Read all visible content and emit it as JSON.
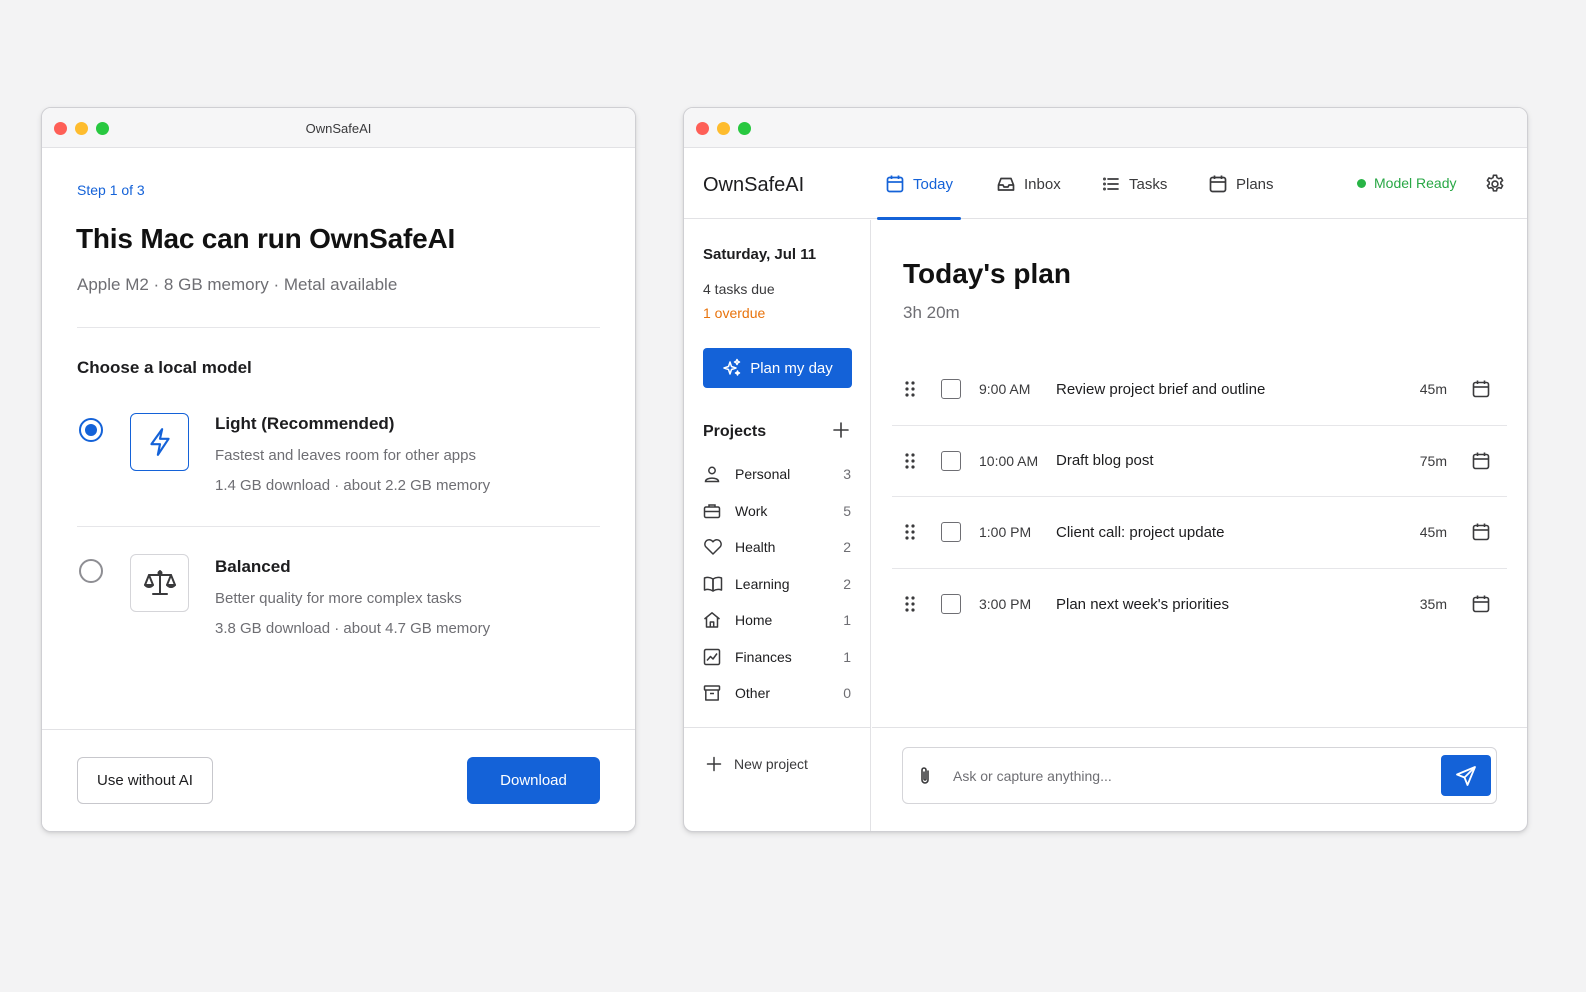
{
  "onboarding": {
    "window_title": "OwnSafeAI",
    "step": "Step 1 of 3",
    "heading": "This Mac can run OwnSafeAI",
    "specs": "Apple M2 · 8 GB memory · Metal available",
    "section_title": "Choose a local model",
    "models": [
      {
        "name": "Light (Recommended)",
        "description": "Fastest and leaves room for other apps",
        "size": "1.4 GB download · about 2.2 GB memory",
        "selected": true,
        "icon": "lightning-icon"
      },
      {
        "name": "Balanced",
        "description": "Better quality for more complex tasks",
        "size": "3.8 GB download · about 4.7 GB memory",
        "selected": false,
        "icon": "scale-icon"
      }
    ],
    "secondary_button": "Use without AI",
    "primary_button": "Download"
  },
  "app": {
    "brand": "OwnSafeAI",
    "tabs": [
      {
        "label": "Today",
        "icon": "calendar-icon",
        "active": true
      },
      {
        "label": "Inbox",
        "icon": "inbox-icon",
        "active": false
      },
      {
        "label": "Tasks",
        "icon": "list-icon",
        "active": false
      },
      {
        "label": "Plans",
        "icon": "calendar-icon",
        "active": false
      }
    ],
    "status": "Model Ready",
    "sidebar": {
      "date": "Saturday, Jul 11",
      "tasks_due": "4 tasks due",
      "overdue": "1 overdue",
      "plan_button": "Plan my day",
      "projects_title": "Projects",
      "projects": [
        {
          "name": "Personal",
          "count": "3",
          "icon": "person-icon"
        },
        {
          "name": "Work",
          "count": "5",
          "icon": "briefcase-icon"
        },
        {
          "name": "Health",
          "count": "2",
          "icon": "heart-icon"
        },
        {
          "name": "Learning",
          "count": "2",
          "icon": "book-icon"
        },
        {
          "name": "Home",
          "count": "1",
          "icon": "house-icon"
        },
        {
          "name": "Finances",
          "count": "1",
          "icon": "chart-icon"
        },
        {
          "name": "Other",
          "count": "0",
          "icon": "archive-icon"
        }
      ],
      "new_project": "New project"
    },
    "main": {
      "title": "Today's plan",
      "duration": "3h 20m",
      "tasks": [
        {
          "time": "9:00 AM",
          "title": "Review project brief and outline",
          "duration": "45m"
        },
        {
          "time": "10:00 AM",
          "title": "Draft blog post",
          "duration": "75m"
        },
        {
          "time": "1:00 PM",
          "title": "Client call: project update",
          "duration": "45m"
        },
        {
          "time": "3:00 PM",
          "title": "Plan next week's priorities",
          "duration": "35m"
        }
      ],
      "composer_placeholder": "Ask or capture anything..."
    },
    "colors": {
      "accent": "#1462d8",
      "ready": "#28b446",
      "overdue": "#e8730c"
    }
  }
}
